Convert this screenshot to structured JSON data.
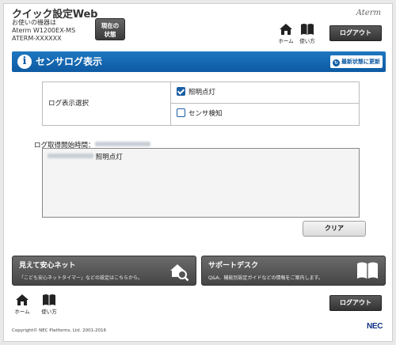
{
  "header": {
    "app_title": "クイック設定Web",
    "device_label": "お使いの機器は",
    "device_model": "Aterm W1200EX-MS",
    "device_id": "ATERM-XXXXXX",
    "status_button_line1": "現在の",
    "status_button_line2": "状態",
    "brand": "Aterm",
    "home_label": "ホーム",
    "help_label": "使い方",
    "logout_label": "ログアウト"
  },
  "page": {
    "title": "センサログ表示",
    "refresh_label": "最新状態に更新"
  },
  "settings": {
    "row_label": "ログ表示選択",
    "options": [
      {
        "label": "照明点灯",
        "checked": true
      },
      {
        "label": "センサ検知",
        "checked": false
      }
    ]
  },
  "log": {
    "start_time_label": "ログ取得開始時間：",
    "entries": [
      {
        "event": "照明点灯"
      }
    ],
    "clear_label": "クリア"
  },
  "banners": [
    {
      "title": "見えて安心ネット",
      "desc": "「こども安心ネットタイマー」などの設定はこちらから。"
    },
    {
      "title": "サポートデスク",
      "desc": "Q&A、機能別設定ガイドなどの情報をご案内します。"
    }
  ],
  "footer": {
    "home_label": "ホーム",
    "help_label": "使い方",
    "logout_label": "ログアウト",
    "copyright": "Copyright© NEC Platforms, Ltd. 2001-2016",
    "nec_logo": "NEC"
  },
  "colors": {
    "accent": "#0d5aa3",
    "button_dark": "#3a3a3a"
  }
}
